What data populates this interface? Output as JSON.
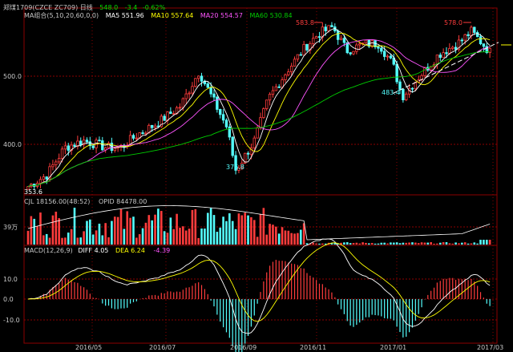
{
  "header": {
    "symbol": "郑煤1709(CZCE ZC709) 日线",
    "last": "548.0",
    "change": "-3.4",
    "change_pct": "-0.62%"
  },
  "ma_legend": {
    "title": "MA组合(5,10,20,60,0,0)",
    "ma5": "MA5 551.96",
    "ma10": "MA10 557.64",
    "ma20": "MA20 554.57",
    "ma60": "MA60 530.84"
  },
  "vol_legend": {
    "cjl": "CJL  18156.00(48:52)",
    "opid": "OPID  84478.00",
    "scale": "39万"
  },
  "macd_legend": {
    "title": "MACD(12,26,9)",
    "diff": "DIFF  4.05",
    "dea": "DEA  6.24",
    "macd": "-4.39"
  },
  "price_axis": [
    "500.0",
    "400.0"
  ],
  "macd_axis": [
    "10.0",
    "0.0",
    "-10.0"
  ],
  "time_axis": [
    "2016/05",
    "2016/07",
    "2016/09",
    "2016/11",
    "2017/01",
    "2017/03"
  ],
  "annotations": {
    "low_start": "353.6",
    "high_1": "583.8",
    "low_1": "376.8",
    "low_2": "483.4",
    "high_2": "578.0"
  },
  "colors": {
    "up": "#ff3c3c",
    "down": "#54ffff",
    "ma5": "#ffffff",
    "ma10": "#ffff00",
    "ma20": "#ff55ff",
    "ma60": "#00cc00",
    "grid": "#8b0000"
  },
  "chart_data": {
    "type": "candlestick",
    "price_ylim": [
      345,
      600
    ],
    "close_points": [
      [
        0,
        353.6
      ],
      [
        0.04,
        370
      ],
      [
        0.08,
        410
      ],
      [
        0.12,
        420
      ],
      [
        0.17,
        410
      ],
      [
        0.2,
        410
      ],
      [
        0.24,
        430
      ],
      [
        0.28,
        445
      ],
      [
        0.33,
        470
      ],
      [
        0.37,
        520
      ],
      [
        0.4,
        480
      ],
      [
        0.43,
        440
      ],
      [
        0.45,
        376.8
      ],
      [
        0.49,
        420
      ],
      [
        0.52,
        480
      ],
      [
        0.56,
        520
      ],
      [
        0.6,
        555
      ],
      [
        0.63,
        575
      ],
      [
        0.66,
        583.8
      ],
      [
        0.69,
        550
      ],
      [
        0.73,
        560
      ],
      [
        0.76,
        560
      ],
      [
        0.79,
        530
      ],
      [
        0.81,
        483.4
      ],
      [
        0.85,
        515
      ],
      [
        0.89,
        545
      ],
      [
        0.93,
        560
      ],
      [
        0.96,
        578
      ],
      [
        1.0,
        548
      ]
    ]
  }
}
